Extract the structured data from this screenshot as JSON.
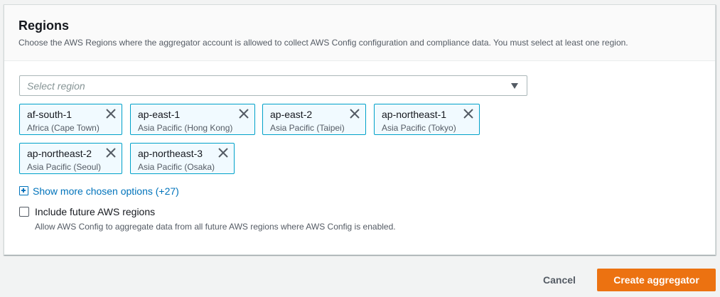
{
  "section": {
    "title": "Regions",
    "description": "Choose the AWS Regions where the aggregator account is allowed to collect AWS Config configuration and compliance data. You must select at least one region."
  },
  "region_select": {
    "placeholder": "Select region",
    "caret_icon": "caret-down-icon"
  },
  "tokens": [
    {
      "name": "af-south-1",
      "description": "Africa (Cape Town)"
    },
    {
      "name": "ap-east-1",
      "description": "Asia Pacific (Hong Kong)"
    },
    {
      "name": "ap-east-2",
      "description": "Asia Pacific (Taipei)"
    },
    {
      "name": "ap-northeast-1",
      "description": "Asia Pacific (Tokyo)"
    },
    {
      "name": "ap-northeast-2",
      "description": "Asia Pacific (Seoul)"
    },
    {
      "name": "ap-northeast-3",
      "description": "Asia Pacific (Osaka)"
    }
  ],
  "token_remove_icon": "close-icon",
  "show_more": {
    "label": "Show more chosen options (+27)",
    "icon": "plus-square-icon"
  },
  "future_regions": {
    "label": "Include future AWS regions",
    "description": "Allow AWS Config to aggregate data from all future AWS regions where AWS Config is enabled.",
    "checked": false
  },
  "footer": {
    "cancel_label": "Cancel",
    "create_label": "Create aggregator"
  },
  "colors": {
    "primary_button": "#ec7211",
    "link": "#0073bb",
    "token_border": "#00a1c9",
    "token_background": "#f1faff"
  }
}
